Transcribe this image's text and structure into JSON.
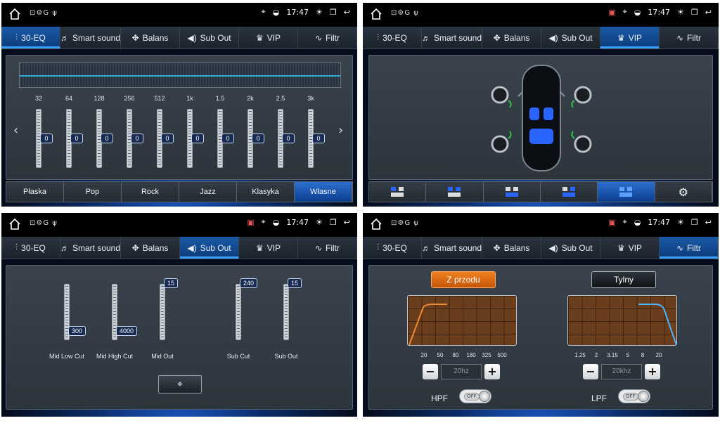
{
  "status": {
    "time": "17:47",
    "left_icons": "⊡⚙G ψ"
  },
  "tabs": [
    "30-EQ",
    "Smart sound",
    "Balans",
    "Sub Out",
    "VIP",
    "Filtr"
  ],
  "eq": {
    "frequencies": [
      "32",
      "64",
      "128",
      "256",
      "512",
      "1k",
      "1.5",
      "2k",
      "2.5",
      "3k"
    ],
    "values": [
      "0",
      "0",
      "0",
      "0",
      "0",
      "0",
      "0",
      "0",
      "0",
      "0"
    ],
    "presets": [
      "Płaska",
      "Pop",
      "Rock",
      "Jazz",
      "Klasyka",
      "Własne"
    ],
    "active_preset": "Własne"
  },
  "subout": {
    "sliders": [
      {
        "label": "Mid Low Cut",
        "value": "300",
        "level": 0.15
      },
      {
        "label": "Mid High Cut",
        "value": "4000",
        "level": 0.15
      },
      {
        "label": "Mid Out",
        "value": "15",
        "level": 1.0
      },
      {
        "label": "Sub Cut",
        "value": "240",
        "level": 1.0
      },
      {
        "label": "Sub Out",
        "value": "15",
        "level": 1.0
      }
    ]
  },
  "filtr": {
    "front_label": "Z przodu",
    "rear_label": "Tylny",
    "hpf_ticks": [
      "20",
      "50",
      "80",
      "180",
      "325",
      "500"
    ],
    "lpf_ticks": [
      "1.25",
      "2",
      "3.15",
      "5",
      "8",
      "20"
    ],
    "hpf_value": "20hz",
    "lpf_value": "20khz",
    "hpf_label": "HPF",
    "lpf_label": "LPF",
    "minus": "−",
    "plus": "+",
    "off": "OFF"
  },
  "colors": {
    "active_tab": "#1a5aa8",
    "accent": "#3ca0ff",
    "front_button": "#e06a10",
    "graph": "#6a3d1c"
  }
}
